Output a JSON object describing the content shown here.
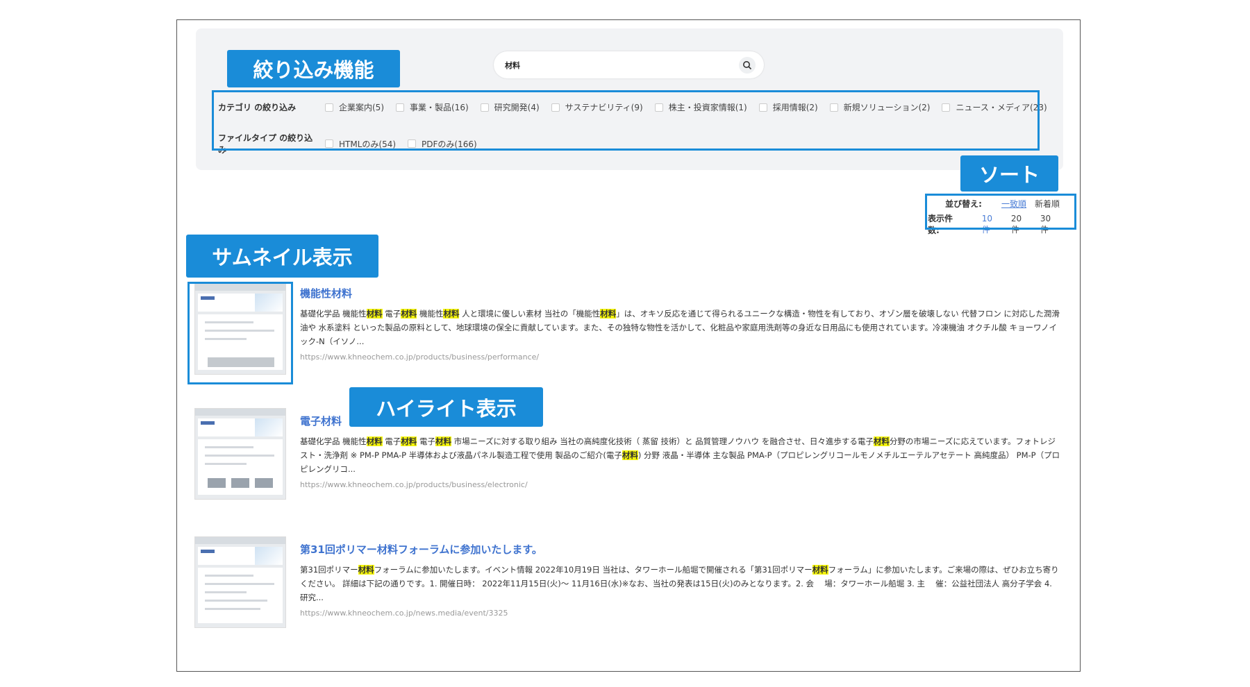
{
  "search": {
    "value": "材料"
  },
  "annotations": {
    "filter": "絞り込み機能",
    "sort": "ソート",
    "thumbnail": "サムネイル表示",
    "highlight": "ハイライト表示"
  },
  "filters": {
    "category": {
      "title": "カテゴリ の絞り込み",
      "options": [
        "企業案内(5)",
        "事業・製品(16)",
        "研究開発(4)",
        "サステナビリティ(9)",
        "株主・投資家情報(1)",
        "採用情報(2)",
        "新規ソリューション(2)",
        "ニュース・メディア(23)"
      ]
    },
    "filetype": {
      "title": "ファイルタイプ の絞り込み",
      "options": [
        "HTMLのみ(54)",
        "PDFのみ(166)"
      ]
    }
  },
  "sort": {
    "title": "並び替え:",
    "options": [
      "一致順",
      "新着順"
    ],
    "active": 0
  },
  "count": {
    "title": "表示件数:",
    "options": [
      "10 件",
      "20 件",
      "30 件"
    ],
    "active": 0
  },
  "results": [
    {
      "title": "機能性材料",
      "snippet_parts": [
        {
          "t": "基礎化学品 機能性"
        },
        {
          "t": "材料",
          "h": true
        },
        {
          "t": " 電子"
        },
        {
          "t": "材料",
          "h": true
        },
        {
          "t": " 機能性"
        },
        {
          "t": "材料",
          "h": true
        },
        {
          "t": " 人と環境に優しい素材 当社の「機能性"
        },
        {
          "t": "材料",
          "h": true
        },
        {
          "t": "」は、オキソ反応を通じて得られるユニークな構造・物性を有しており、オゾン層を破壊しない 代替フロン に対応した潤滑油や 水系塗料 といった製品の原料として、地球環境の保全に貢献しています。また、その独特な物性を活かして、化粧品や家庭用洗剤等の身近な日用品にも使用されています。冷凍機油 オクチル酸 キョーワノイック-N（イソノ..."
        }
      ],
      "url": "https://www.khneochem.co.jp/products/business/performance/"
    },
    {
      "title": "電子材料",
      "snippet_parts": [
        {
          "t": "基礎化学品 機能性"
        },
        {
          "t": "材料",
          "h": true
        },
        {
          "t": " 電子"
        },
        {
          "t": "材料",
          "h": true
        },
        {
          "t": " 電子"
        },
        {
          "t": "材料",
          "h": true
        },
        {
          "t": " 市場ニーズに対する取り組み 当社の高純度化技術（ 蒸留 技術）と 品質管理ノウハウ を融合させ、日々進歩する電子"
        },
        {
          "t": "材料",
          "h": true
        },
        {
          "t": "分野の市場ニーズに応えています。フォトレジスト・洗浄剤 ※ PM-P PMA-P 半導体および液晶パネル製造工程で使用 製品のご紹介(電子"
        },
        {
          "t": "材料",
          "h": true
        },
        {
          "t": ") 分野 液晶・半導体 主な製品 PMA-P（プロピレングリコールモノメチルエーテルアセテート 高純度品） PM-P（プロピレングリコ..."
        }
      ],
      "url": "https://www.khneochem.co.jp/products/business/electronic/"
    },
    {
      "title": "第31回ポリマー材料フォーラムに参加いたします。",
      "snippet_parts": [
        {
          "t": "第31回ポリマー"
        },
        {
          "t": "材料",
          "h": true
        },
        {
          "t": "フォーラムに参加いたします。イベント情報 2022年10月19日 当社は、タワーホール船堀で開催される「第31回ポリマー"
        },
        {
          "t": "材料",
          "h": true
        },
        {
          "t": "フォーラム」に参加いたします。ご来場の際は、ぜひお立ち寄りください。 詳細は下記の通りです。1. 開催日時： 2022年11月15日(火)～ 11月16日(水)※なお、当社の発表は15日(火)のみとなります。2. 会　 場：タワーホール船堀 3. 主　 催：公益社団法人 高分子学会 4. 研究..."
        }
      ],
      "url": "https://www.khneochem.co.jp/news.media/event/3325"
    }
  ]
}
